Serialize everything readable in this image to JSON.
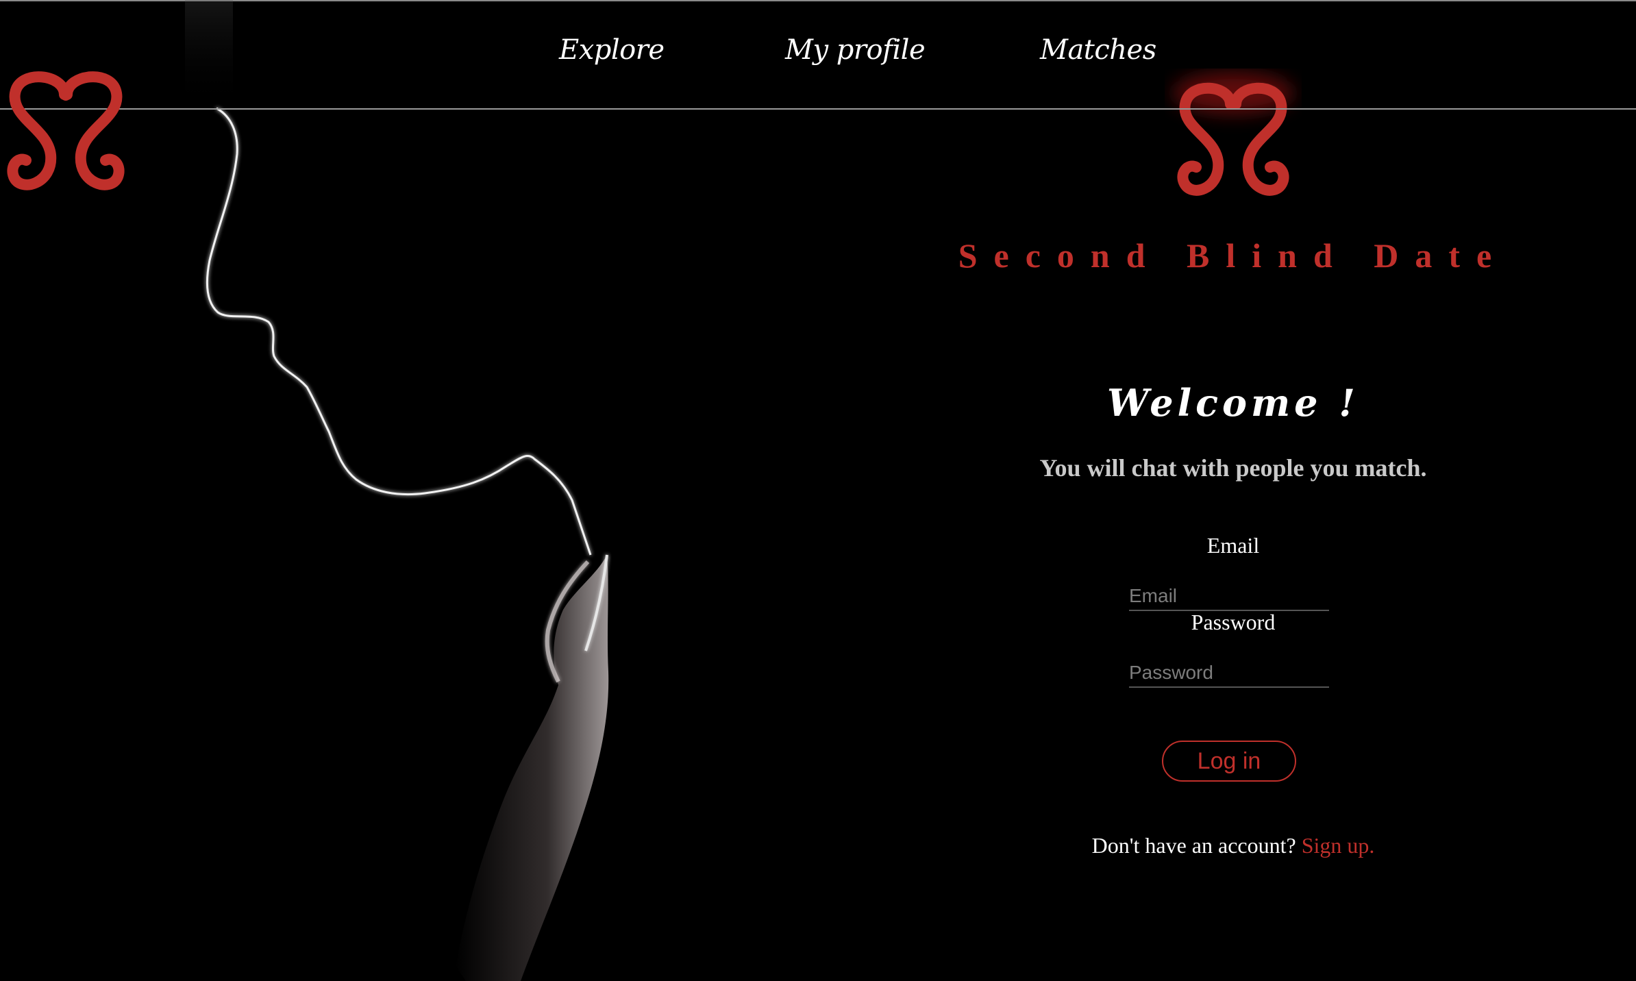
{
  "nav": {
    "links": [
      {
        "label": "Explore"
      },
      {
        "label": "My profile"
      },
      {
        "label": "Matches"
      }
    ]
  },
  "brand": {
    "name": "Second Blind Date",
    "logo_icon": "double-s-heart-logo-icon"
  },
  "login": {
    "welcome": "Welcome !",
    "subtitle": "You will chat with people you match.",
    "email_label": "Email",
    "email_placeholder": "Email",
    "email_value": "",
    "password_label": "Password",
    "password_placeholder": "Password",
    "password_value": "",
    "login_button": "Log in",
    "signup_prompt": "Don't have an account?",
    "signup_link": "Sign up."
  },
  "colors": {
    "background": "#000000",
    "accent": "#c0302b",
    "text": "#ffffff",
    "subtitle": "#c9c9c9",
    "divider": "#9a9a9a"
  }
}
